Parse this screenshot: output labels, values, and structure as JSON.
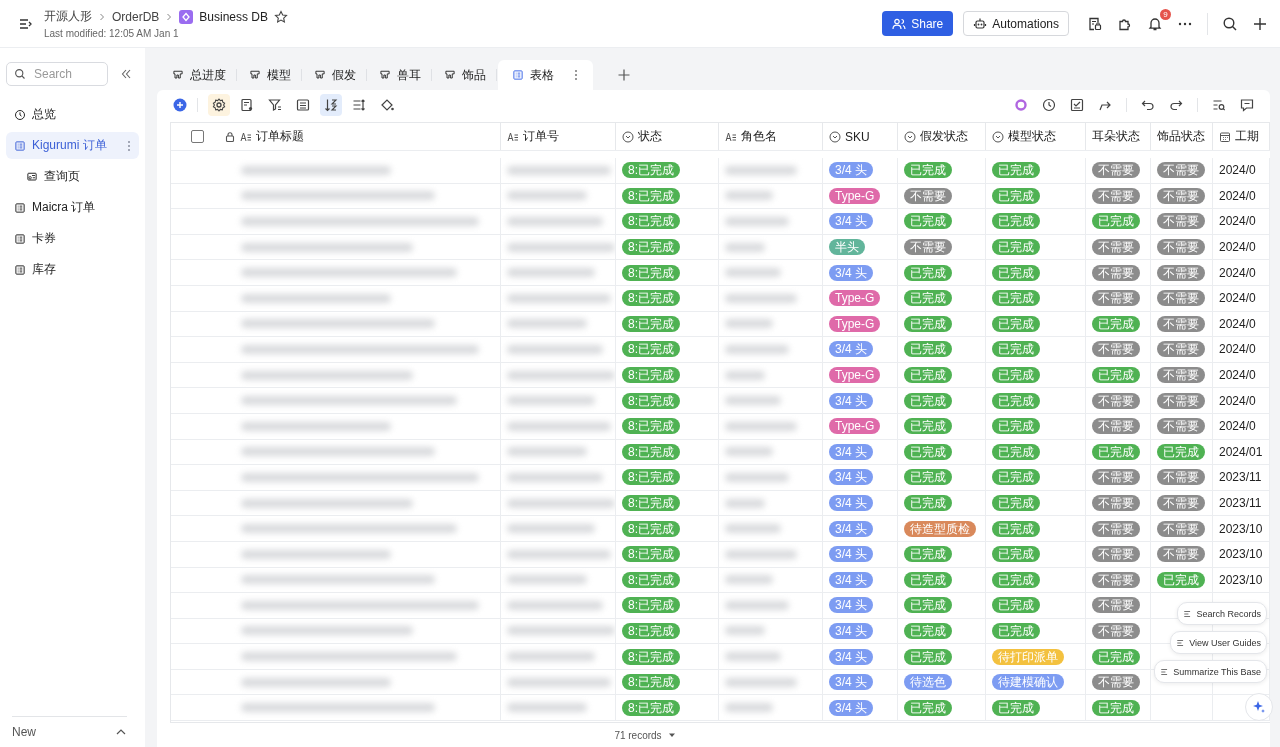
{
  "header": {
    "breadcrumb": [
      "开源人形",
      "OrderDB"
    ],
    "base_name": "Business DB",
    "last_modified": "Last modified: 12:05 AM Jan 1",
    "share": "Share",
    "automations": "Automations",
    "notification_count": "9"
  },
  "sidebar": {
    "search": {
      "placeholder": "Search"
    },
    "items": [
      {
        "label": "总览",
        "kind": "dashboard",
        "selected": false
      },
      {
        "label": "Kigurumi 订单",
        "kind": "table",
        "selected": true,
        "children": [
          {
            "label": "查询页",
            "kind": "form",
            "selected": false
          }
        ]
      },
      {
        "label": "Maicra 订单",
        "kind": "table",
        "selected": false
      },
      {
        "label": "卡券",
        "kind": "table",
        "selected": false
      },
      {
        "label": "库存",
        "kind": "table",
        "selected": false
      }
    ],
    "footer": "New"
  },
  "tabs": [
    {
      "label": "总进度",
      "kind": "kanban",
      "selected": false
    },
    {
      "label": "模型",
      "kind": "kanban",
      "selected": false
    },
    {
      "label": "假发",
      "kind": "kanban",
      "selected": false
    },
    {
      "label": "兽耳",
      "kind": "kanban",
      "selected": false
    },
    {
      "label": "饰品",
      "kind": "kanban",
      "selected": false
    },
    {
      "label": "表格",
      "kind": "grid",
      "selected": true
    }
  ],
  "toolbar": {
    "fields_highlighted": true,
    "sort_active": true
  },
  "table": {
    "select_all": {
      "checked": false
    },
    "columns": [
      {
        "label": "订单标题",
        "kind": "text",
        "locked": true
      },
      {
        "label": "订单号",
        "kind": "text",
        "locked": false
      },
      {
        "label": "状态",
        "kind": "select",
        "locked": false
      },
      {
        "label": "角色名",
        "kind": "text",
        "locked": false
      },
      {
        "label": "SKU",
        "kind": "select",
        "locked": false
      },
      {
        "label": "假发状态",
        "kind": "select",
        "locked": false
      },
      {
        "label": "模型状态",
        "kind": "select",
        "locked": false
      },
      {
        "label": "耳朵状态",
        "kind": "plain",
        "locked": false
      },
      {
        "label": "饰品状态",
        "kind": "plain",
        "locked": false
      },
      {
        "label": "工期",
        "kind": "date",
        "locked": false
      }
    ],
    "rows": [
      {
        "tags": [
          {
            "text": "8:已完成",
            "color": "#4fb253"
          },
          {
            "text": "3/4 头",
            "color": "#7d9cf2"
          },
          {
            "text": "已完成",
            "color": "#4fb253"
          },
          {
            "text": "已完成",
            "color": "#4fb253"
          },
          {
            "text": "不需要",
            "color": "#8c8c8c"
          },
          {
            "text": "不需要",
            "color": "#8c8c8c"
          }
        ],
        "date": "2024/0"
      },
      {
        "tags": [
          {
            "text": "8:已完成",
            "color": "#4fb253"
          },
          {
            "text": "Type-G",
            "color": "#df6aa9"
          },
          {
            "text": "不需要",
            "color": "#8c8c8c"
          },
          {
            "text": "已完成",
            "color": "#4fb253"
          },
          {
            "text": "不需要",
            "color": "#8c8c8c"
          },
          {
            "text": "不需要",
            "color": "#8c8c8c"
          }
        ],
        "date": "2024/0"
      },
      {
        "tags": [
          {
            "text": "8:已完成",
            "color": "#4fb253"
          },
          {
            "text": "3/4 头",
            "color": "#7d9cf2"
          },
          {
            "text": "已完成",
            "color": "#4fb253"
          },
          {
            "text": "已完成",
            "color": "#4fb253"
          },
          {
            "text": "已完成",
            "color": "#4fb253"
          },
          {
            "text": "不需要",
            "color": "#8c8c8c"
          }
        ],
        "date": "2024/0"
      },
      {
        "tags": [
          {
            "text": "8:已完成",
            "color": "#4fb253"
          },
          {
            "text": "半头",
            "color": "#62b59b"
          },
          {
            "text": "不需要",
            "color": "#8c8c8c"
          },
          {
            "text": "已完成",
            "color": "#4fb253"
          },
          {
            "text": "不需要",
            "color": "#8c8c8c"
          },
          {
            "text": "不需要",
            "color": "#8c8c8c"
          }
        ],
        "date": "2024/0"
      },
      {
        "tags": [
          {
            "text": "8:已完成",
            "color": "#4fb253"
          },
          {
            "text": "3/4 头",
            "color": "#7d9cf2"
          },
          {
            "text": "已完成",
            "color": "#4fb253"
          },
          {
            "text": "已完成",
            "color": "#4fb253"
          },
          {
            "text": "不需要",
            "color": "#8c8c8c"
          },
          {
            "text": "不需要",
            "color": "#8c8c8c"
          }
        ],
        "date": "2024/0"
      },
      {
        "tags": [
          {
            "text": "8:已完成",
            "color": "#4fb253"
          },
          {
            "text": "Type-G",
            "color": "#df6aa9"
          },
          {
            "text": "已完成",
            "color": "#4fb253"
          },
          {
            "text": "已完成",
            "color": "#4fb253"
          },
          {
            "text": "不需要",
            "color": "#8c8c8c"
          },
          {
            "text": "不需要",
            "color": "#8c8c8c"
          }
        ],
        "date": "2024/0"
      },
      {
        "tags": [
          {
            "text": "8:已完成",
            "color": "#4fb253"
          },
          {
            "text": "Type-G",
            "color": "#df6aa9"
          },
          {
            "text": "已完成",
            "color": "#4fb253"
          },
          {
            "text": "已完成",
            "color": "#4fb253"
          },
          {
            "text": "已完成",
            "color": "#4fb253"
          },
          {
            "text": "不需要",
            "color": "#8c8c8c"
          }
        ],
        "date": "2024/0"
      },
      {
        "tags": [
          {
            "text": "8:已完成",
            "color": "#4fb253"
          },
          {
            "text": "3/4 头",
            "color": "#7d9cf2"
          },
          {
            "text": "已完成",
            "color": "#4fb253"
          },
          {
            "text": "已完成",
            "color": "#4fb253"
          },
          {
            "text": "不需要",
            "color": "#8c8c8c"
          },
          {
            "text": "不需要",
            "color": "#8c8c8c"
          }
        ],
        "date": "2024/0"
      },
      {
        "tags": [
          {
            "text": "8:已完成",
            "color": "#4fb253"
          },
          {
            "text": "Type-G",
            "color": "#df6aa9"
          },
          {
            "text": "已完成",
            "color": "#4fb253"
          },
          {
            "text": "已完成",
            "color": "#4fb253"
          },
          {
            "text": "已完成",
            "color": "#4fb253"
          },
          {
            "text": "不需要",
            "color": "#8c8c8c"
          }
        ],
        "date": "2024/0"
      },
      {
        "tags": [
          {
            "text": "8:已完成",
            "color": "#4fb253"
          },
          {
            "text": "3/4 头",
            "color": "#7d9cf2"
          },
          {
            "text": "已完成",
            "color": "#4fb253"
          },
          {
            "text": "已完成",
            "color": "#4fb253"
          },
          {
            "text": "不需要",
            "color": "#8c8c8c"
          },
          {
            "text": "不需要",
            "color": "#8c8c8c"
          }
        ],
        "date": "2024/0"
      },
      {
        "tags": [
          {
            "text": "8:已完成",
            "color": "#4fb253"
          },
          {
            "text": "Type-G",
            "color": "#df6aa9"
          },
          {
            "text": "已完成",
            "color": "#4fb253"
          },
          {
            "text": "已完成",
            "color": "#4fb253"
          },
          {
            "text": "不需要",
            "color": "#8c8c8c"
          },
          {
            "text": "不需要",
            "color": "#8c8c8c"
          }
        ],
        "date": "2024/0"
      },
      {
        "tags": [
          {
            "text": "8:已完成",
            "color": "#4fb253"
          },
          {
            "text": "3/4 头",
            "color": "#7d9cf2"
          },
          {
            "text": "已完成",
            "color": "#4fb253"
          },
          {
            "text": "已完成",
            "color": "#4fb253"
          },
          {
            "text": "已完成",
            "color": "#4fb253"
          },
          {
            "text": "已完成",
            "color": "#4fb253"
          }
        ],
        "date": "2024/01"
      },
      {
        "tags": [
          {
            "text": "8:已完成",
            "color": "#4fb253"
          },
          {
            "text": "3/4 头",
            "color": "#7d9cf2"
          },
          {
            "text": "已完成",
            "color": "#4fb253"
          },
          {
            "text": "已完成",
            "color": "#4fb253"
          },
          {
            "text": "不需要",
            "color": "#8c8c8c"
          },
          {
            "text": "不需要",
            "color": "#8c8c8c"
          }
        ],
        "date": "2023/11"
      },
      {
        "tags": [
          {
            "text": "8:已完成",
            "color": "#4fb253"
          },
          {
            "text": "3/4 头",
            "color": "#7d9cf2"
          },
          {
            "text": "已完成",
            "color": "#4fb253"
          },
          {
            "text": "已完成",
            "color": "#4fb253"
          },
          {
            "text": "不需要",
            "color": "#8c8c8c"
          },
          {
            "text": "不需要",
            "color": "#8c8c8c"
          }
        ],
        "date": "2023/11"
      },
      {
        "tags": [
          {
            "text": "8:已完成",
            "color": "#4fb253"
          },
          {
            "text": "3/4 头",
            "color": "#7d9cf2"
          },
          {
            "text": "待造型质检",
            "color": "#d9895b"
          },
          {
            "text": "已完成",
            "color": "#4fb253"
          },
          {
            "text": "不需要",
            "color": "#8c8c8c"
          },
          {
            "text": "不需要",
            "color": "#8c8c8c"
          }
        ],
        "date": "2023/10"
      },
      {
        "tags": [
          {
            "text": "8:已完成",
            "color": "#4fb253"
          },
          {
            "text": "3/4 头",
            "color": "#7d9cf2"
          },
          {
            "text": "已完成",
            "color": "#4fb253"
          },
          {
            "text": "已完成",
            "color": "#4fb253"
          },
          {
            "text": "不需要",
            "color": "#8c8c8c"
          },
          {
            "text": "不需要",
            "color": "#8c8c8c"
          }
        ],
        "date": "2023/10"
      },
      {
        "tags": [
          {
            "text": "8:已完成",
            "color": "#4fb253"
          },
          {
            "text": "3/4 头",
            "color": "#7d9cf2"
          },
          {
            "text": "已完成",
            "color": "#4fb253"
          },
          {
            "text": "已完成",
            "color": "#4fb253"
          },
          {
            "text": "不需要",
            "color": "#8c8c8c"
          },
          {
            "text": "已完成",
            "color": "#4fb253"
          }
        ],
        "date": "2023/10"
      },
      {
        "tags": [
          {
            "text": "8:已完成",
            "color": "#4fb253"
          },
          {
            "text": "3/4 头",
            "color": "#7d9cf2"
          },
          {
            "text": "已完成",
            "color": "#4fb253"
          },
          {
            "text": "已完成",
            "color": "#4fb253"
          },
          {
            "text": "不需要",
            "color": "#8c8c8c"
          }
        ]
      },
      {
        "tags": [
          {
            "text": "8:已完成",
            "color": "#4fb253"
          },
          {
            "text": "3/4 头",
            "color": "#7d9cf2"
          },
          {
            "text": "已完成",
            "color": "#4fb253"
          },
          {
            "text": "已完成",
            "color": "#4fb253"
          },
          {
            "text": "不需要",
            "color": "#8c8c8c"
          }
        ]
      },
      {
        "tags": [
          {
            "text": "8:已完成",
            "color": "#4fb253"
          },
          {
            "text": "3/4 头",
            "color": "#7d9cf2"
          },
          {
            "text": "已完成",
            "color": "#4fb253"
          },
          {
            "text": "待打印派单",
            "color": "#f3c13f"
          },
          {
            "text": "已完成",
            "color": "#4fb253"
          }
        ]
      },
      {
        "tags": [
          {
            "text": "8:已完成",
            "color": "#4fb253"
          },
          {
            "text": "3/4 头",
            "color": "#7d9cf2"
          },
          {
            "text": "待选色",
            "color": "#7d9cf2"
          },
          {
            "text": "待建模确认",
            "color": "#7d9cf2"
          },
          {
            "text": "不需要",
            "color": "#8c8c8c"
          }
        ]
      },
      {
        "tags": [
          {
            "text": "8:已完成",
            "color": "#4fb253"
          },
          {
            "text": "3/4 头",
            "color": "#7d9cf2"
          },
          {
            "text": "已完成",
            "color": "#4fb253"
          },
          {
            "text": "已完成",
            "color": "#4fb253"
          },
          {
            "text": "已完成",
            "color": "#4fb253"
          }
        ]
      }
    ]
  },
  "records": "71 records",
  "assistant": [
    "Search Records",
    "View User Guides",
    "Summarize This Base"
  ]
}
